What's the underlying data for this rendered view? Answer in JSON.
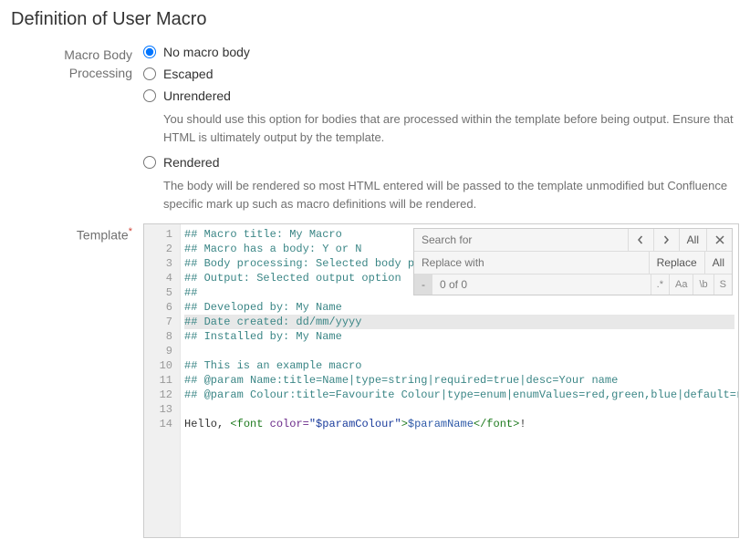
{
  "heading": "Definition of User Macro",
  "macroBody": {
    "label_line1": "Macro Body",
    "label_line2": "Processing",
    "options": {
      "no_body": "No macro body",
      "escaped": "Escaped",
      "unrendered": "Unrendered",
      "unrendered_desc": "You should use this option for bodies that are processed within the template before being output. Ensure that HTML is ultimately output by the template.",
      "rendered": "Rendered",
      "rendered_desc": "The body will be rendered so most HTML entered will be passed to the template unmodified but Confluence specific mark up such as macro definitions will be rendered."
    },
    "selected": "no_body"
  },
  "template": {
    "label": "Template",
    "required_mark": "*",
    "lines": [
      "## Macro title: My Macro",
      "## Macro has a body: Y or N",
      "## Body processing: Selected body proc",
      "## Output: Selected output option",
      "##",
      "## Developed by: My Name",
      "## Date created: dd/mm/yyyy",
      "## Installed by: My Name",
      "",
      "## This is an example macro",
      "## @param Name:title=Name|type=string|required=true|desc=Your name",
      "## @param Colour:title=Favourite Colour|type=enum|enumValues=red,green,blue|default=red"
    ],
    "line13_blank": "",
    "line14": {
      "prefix": "Hello, ",
      "open_tag": "<font",
      "attr": " color=",
      "attr_val": "\"$paramColour\"",
      "gt": ">",
      "var": "$paramName",
      "close_tag": "</font>",
      "suffix": "!"
    },
    "highlighted_line": 7
  },
  "searchPanel": {
    "search_placeholder": "Search for",
    "replace_placeholder": "Replace with",
    "all_label": "All",
    "replace_label": "Replace",
    "status_dash": "-",
    "status_text": "0 of 0",
    "toggle_regex": ".*",
    "toggle_case": "Aa",
    "toggle_word": "\\b",
    "toggle_sel": "S"
  },
  "gutter_numbers": [
    "1",
    "2",
    "3",
    "4",
    "5",
    "6",
    "7",
    "8",
    "9",
    "10",
    "11",
    "12",
    "13",
    "14"
  ]
}
